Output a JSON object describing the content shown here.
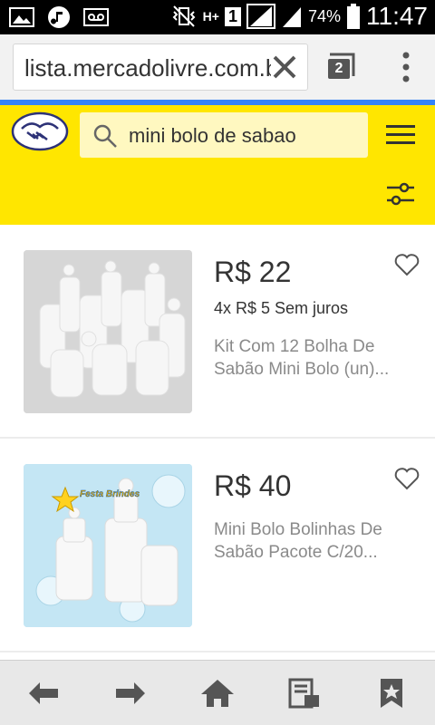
{
  "status_bar": {
    "battery_percent": "74%",
    "time": "11:47",
    "network_type": "H+",
    "sim_slot": "1"
  },
  "browser": {
    "url": "lista.mercadolivre.com.br",
    "tab_count": "2"
  },
  "header": {
    "search_query": "mini bolo de sabao",
    "accent_color": "#ffe600"
  },
  "listings": [
    {
      "price": "R$ 22",
      "installments": "4x R$ 5 Sem juros",
      "title": "Kit Com 12 Bolha De Sabão Mini Bolo (un)..."
    },
    {
      "price": "R$ 40",
      "installments": "",
      "title": "Mini Bolo Bolinhas De Sabão Pacote C/20...",
      "image_watermark": "Festa Brindes"
    }
  ],
  "bottom_nav": {
    "items": [
      "back-arrow-icon",
      "forward-arrow-icon",
      "home-icon",
      "reader-icon",
      "bookmark-star-icon"
    ]
  }
}
